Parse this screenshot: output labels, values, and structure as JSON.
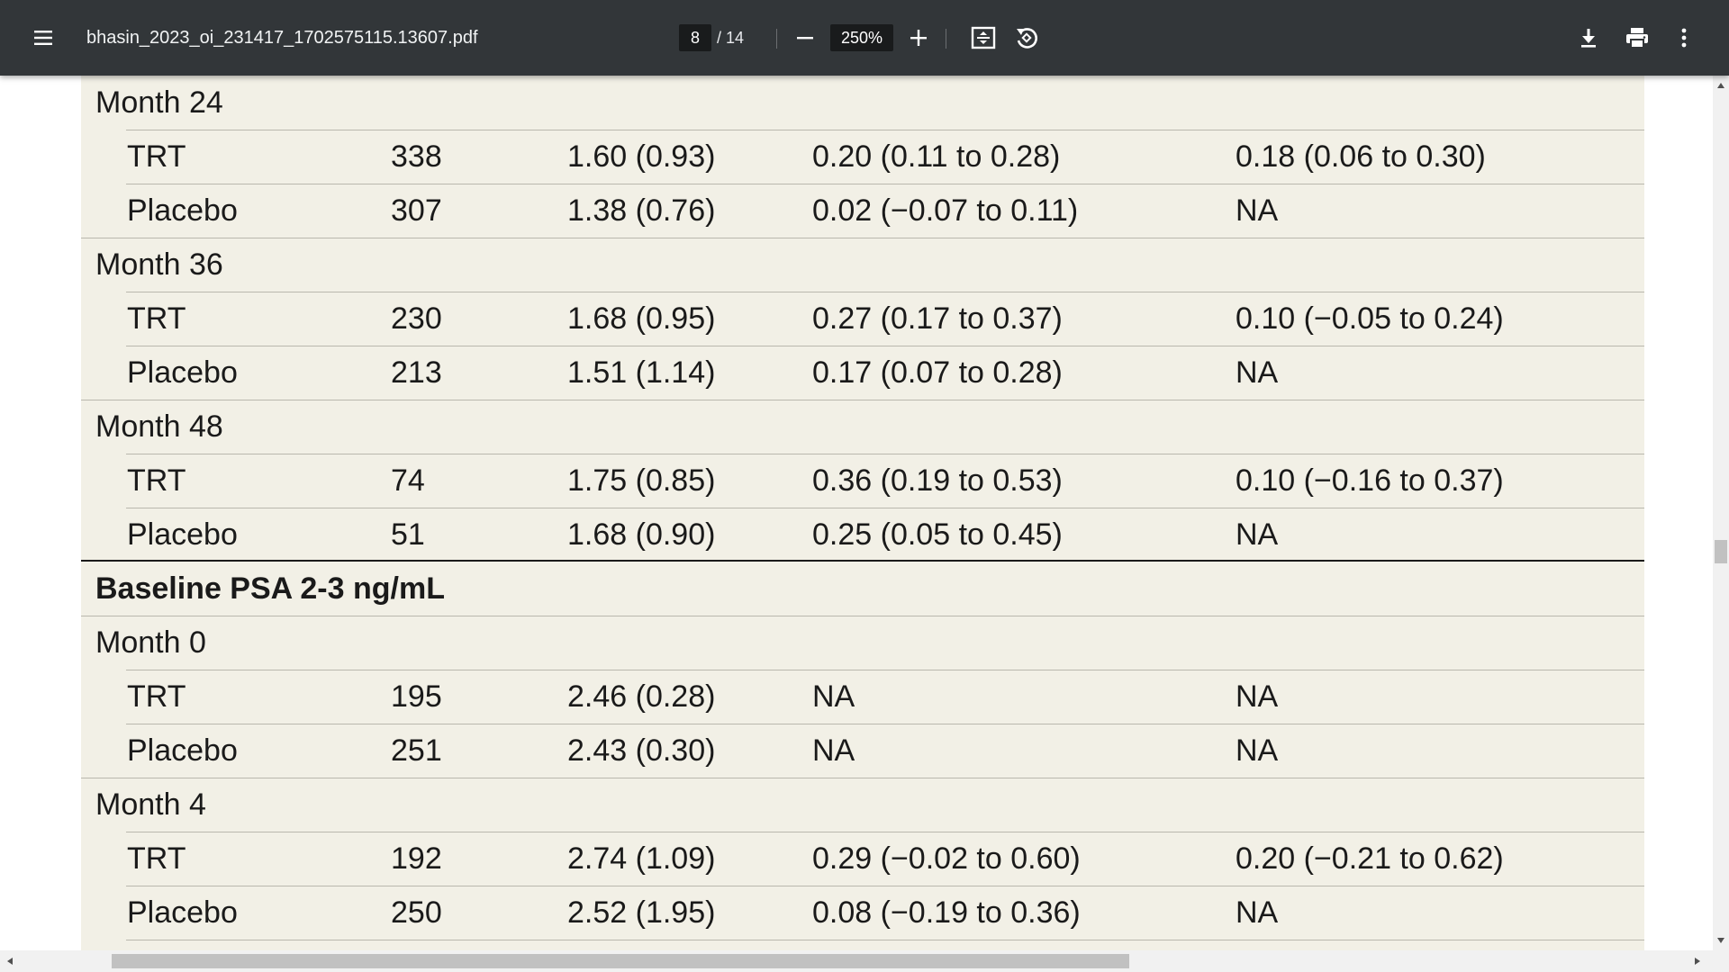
{
  "toolbar": {
    "document_title": "bhasin_2023_oi_231417_1702575115.13607.pdf",
    "current_page": "8",
    "total_pages": "/ 14",
    "zoom": "250%",
    "icons": {
      "menu": "hamburger-menu-icon",
      "zoom_out": "minus-icon",
      "zoom_in": "plus-icon",
      "fit": "fit-to-page-icon",
      "rotate": "rotate-icon",
      "download": "download-icon",
      "print": "print-icon",
      "more": "more-vert-icon"
    },
    "colors": {
      "bar_background": "#323639",
      "input_background": "#191b1c"
    }
  },
  "page": {
    "background_color": "#f2f0e6",
    "rows": [
      {
        "type": "group",
        "label": "Month 24"
      },
      {
        "type": "data",
        "group": "TRT",
        "n": "338",
        "mean_sd": "1.60 (0.93)",
        "change": "0.20 (0.11 to 0.28)",
        "diff": "0.18 (0.06 to 0.30)"
      },
      {
        "type": "data",
        "group": "Placebo",
        "n": "307",
        "mean_sd": "1.38 (0.76)",
        "change": "0.02 (−0.07 to 0.11)",
        "diff": "NA"
      },
      {
        "type": "group",
        "label": "Month 36"
      },
      {
        "type": "data",
        "group": "TRT",
        "n": "230",
        "mean_sd": "1.68 (0.95)",
        "change": "0.27 (0.17 to 0.37)",
        "diff": "0.10 (−0.05 to 0.24)"
      },
      {
        "type": "data",
        "group": "Placebo",
        "n": "213",
        "mean_sd": "1.51 (1.14)",
        "change": "0.17 (0.07 to 0.28)",
        "diff": "NA"
      },
      {
        "type": "group",
        "label": "Month 48"
      },
      {
        "type": "data",
        "group": "TRT",
        "n": "74",
        "mean_sd": "1.75 (0.85)",
        "change": "0.36 (0.19 to 0.53)",
        "diff": "0.10 (−0.16 to 0.37)"
      },
      {
        "type": "data",
        "group": "Placebo",
        "n": "51",
        "mean_sd": "1.68 (0.90)",
        "change": "0.25 (0.05 to 0.45)",
        "diff": "NA"
      },
      {
        "type": "section",
        "label": "Baseline PSA 2-3 ng/mL"
      },
      {
        "type": "group",
        "label": "Month 0"
      },
      {
        "type": "data",
        "group": "TRT",
        "n": "195",
        "mean_sd": "2.46 (0.28)",
        "change": "NA",
        "diff": "NA"
      },
      {
        "type": "data",
        "group": "Placebo",
        "n": "251",
        "mean_sd": "2.43 (0.30)",
        "change": "NA",
        "diff": "NA"
      },
      {
        "type": "group",
        "label": "Month 4"
      },
      {
        "type": "data",
        "group": "TRT",
        "n": "192",
        "mean_sd": "2.74 (1.09)",
        "change": "0.29 (−0.02 to 0.60)",
        "diff": "0.20 (−0.21 to 0.62)"
      },
      {
        "type": "data",
        "group": "Placebo",
        "n": "250",
        "mean_sd": "2.52 (1.95)",
        "change": "0.08 (−0.19 to 0.36)",
        "diff": "NA"
      }
    ]
  }
}
